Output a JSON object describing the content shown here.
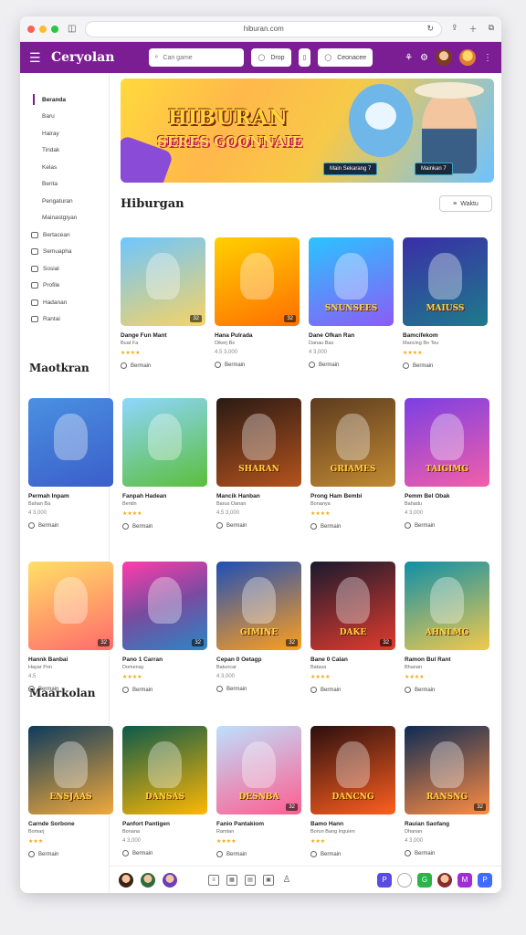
{
  "browser": {
    "url": "hiburan.com",
    "traffic_colors": [
      "#ff5f57",
      "#febc2e",
      "#28c840"
    ]
  },
  "appbar": {
    "brand": "Ceryolan",
    "search_placeholder": "Cari game",
    "filter_label": "Drop",
    "category_label": "Ceonacee"
  },
  "sidebar": {
    "items": [
      "Beranda",
      "Baru",
      "Hairay",
      "Tindak",
      "Kelas",
      "Berita",
      "Pengaturan",
      "Mainastgiyan"
    ],
    "icon_items": [
      "Bertacean",
      "Semuapha",
      "Sosial",
      "Profile",
      "Hadanan",
      "Rantai"
    ],
    "section_label": "Maotkran",
    "section_label_2": "Maarkolan"
  },
  "banner": {
    "title": "HIBURAN",
    "subtitle": "SERES GOONNAIE",
    "btn1": "Main Sekarang 7",
    "btn2": "Mainkan 7"
  },
  "sections": {
    "heading": "Hiburgan",
    "sort_label": "Waktu"
  },
  "rows": [
    {
      "cards": [
        {
          "title": "Dange Fun Mant",
          "sub": "Buat Fa",
          "stars": "★★★★",
          "rating": "",
          "action": "Bermain",
          "badge": "32",
          "logo": "",
          "bg": "linear-gradient(160deg,#6ec6ff,#f6d365)"
        },
        {
          "title": "Hana Pulrada",
          "sub": "Dikerj Bs",
          "stars": "",
          "rating": "4.5  3,000",
          "action": "Bermain",
          "badge": "32",
          "logo": "",
          "bg": "linear-gradient(160deg,#ffd000,#ff6f00)"
        },
        {
          "title": "Dane Ofkan Ran",
          "sub": "Danau Bas",
          "stars": "",
          "rating": "4  3,000",
          "action": "Bermain",
          "badge": "",
          "logo": "SNUNSEES",
          "bg": "linear-gradient(160deg,#2ac4ff,#8b5cf6)"
        },
        {
          "title": "Bamcifekom",
          "sub": "Mancing Bo Teu",
          "stars": "★★★★",
          "rating": "",
          "action": "Bermain",
          "badge": "",
          "logo": "MAIUSS",
          "bg": "linear-gradient(160deg,#3b2ea8,#1d7b8a)"
        }
      ]
    },
    {
      "cards": [
        {
          "title": "Permah Inpam",
          "sub": "Bahan Ba",
          "stars": "",
          "rating": "4  3,000",
          "action": "Bermain",
          "badge": "",
          "logo": "",
          "bg": "linear-gradient(160deg,#4a90e2,#3b5fc9)"
        },
        {
          "title": "Fanpah Hadean",
          "sub": "Bentin",
          "stars": "★★★★",
          "rating": "",
          "action": "Bermain",
          "badge": "",
          "logo": "",
          "bg": "linear-gradient(160deg,#8fd6ff,#5bbf3a)"
        },
        {
          "title": "Mancik Hanban",
          "sub": "Barus Oanan",
          "stars": "",
          "rating": "4.5  3,000",
          "action": "Bermain",
          "badge": "",
          "logo": "SHARAN",
          "bg": "linear-gradient(160deg,#2a1a14,#b4531d)"
        },
        {
          "title": "Prong Ham Bembi",
          "sub": "Bonanya",
          "stars": "★★★★",
          "rating": "",
          "action": "Bermain",
          "badge": "",
          "logo": "GRIAMES",
          "bg": "linear-gradient(160deg,#5c3b1e,#c28a34)"
        },
        {
          "title": "Pemm Bel Obak",
          "sub": "Bahadu",
          "stars": "",
          "rating": "4  3,000",
          "action": "Bermain",
          "badge": "",
          "logo": "TAIGIMG",
          "bg": "linear-gradient(160deg,#7b3fe4,#f35fa8)"
        }
      ]
    },
    {
      "cards": [
        {
          "title": "Hannk Banbai",
          "sub": "Hayar Pon",
          "stars": "",
          "rating": "4.5",
          "action": "Bermain",
          "badge": "32",
          "logo": "",
          "bg": "linear-gradient(160deg,#ffe066,#ff6b6b)"
        },
        {
          "title": "Pano 1 Carran",
          "sub": "Domenay",
          "stars": "★★★★",
          "rating": "",
          "action": "Bermain",
          "badge": "32",
          "logo": "",
          "bg": "linear-gradient(160deg,#ff3cac,#784ba0,#2b86c5)"
        },
        {
          "title": "Cepan 0 Oetagp",
          "sub": "Batuncar",
          "stars": "",
          "rating": "4  3,000",
          "action": "Bermain",
          "badge": "32",
          "logo": "GIMINE",
          "bg": "linear-gradient(160deg,#1f4fb8,#ff9f1c)"
        },
        {
          "title": "Bane 0 Calan",
          "sub": "Batasa",
          "stars": "★★★★",
          "rating": "",
          "action": "Bermain",
          "badge": "32",
          "logo": "DAKE",
          "bg": "linear-gradient(160deg,#1a1a2e,#e23b2e)"
        },
        {
          "title": "Ramon Bul Rant",
          "sub": "Bhanan",
          "stars": "★★★★",
          "rating": "",
          "action": "Bermain",
          "badge": "",
          "logo": "AHNLMG",
          "bg": "linear-gradient(160deg,#0f8fa8,#f2c94c)"
        }
      ]
    },
    {
      "cards": [
        {
          "title": "Carnde Sorbone",
          "sub": "Bomarj",
          "stars": "★★★",
          "rating": "",
          "action": "Bermain",
          "badge": "",
          "logo": "ENSJAAS",
          "bg": "linear-gradient(160deg,#0e3b5c,#f2a93b)"
        },
        {
          "title": "Panfort Pantigen",
          "sub": "Bonana",
          "stars": "",
          "rating": "4  3,000",
          "action": "Bermain",
          "badge": "",
          "logo": "DANSAS",
          "bg": "linear-gradient(160deg,#0c5a4a,#ffb703)"
        },
        {
          "title": "Fanio Pantakiom",
          "sub": "Ramtan",
          "stars": "★★★★",
          "rating": "",
          "action": "Bermain",
          "badge": "32",
          "logo": "DESNBA",
          "bg": "linear-gradient(160deg,#bde0fe,#ff5d8f)"
        },
        {
          "title": "Bamo Hann",
          "sub": "Borun Bang Inguien",
          "stars": "★★★",
          "rating": "",
          "action": "Bermain",
          "badge": "",
          "logo": "DANCNG",
          "bg": "linear-gradient(160deg,#2b0f0f,#ff5f1f)"
        },
        {
          "title": "Rauian Saofang",
          "sub": "Dhanan",
          "stars": "",
          "rating": "4  3,000",
          "action": "Bermain",
          "badge": "32",
          "logo": "RANSNG",
          "bg": "linear-gradient(160deg,#0d2b55,#ff8c42)"
        }
      ]
    }
  ],
  "bottombar": {
    "icons": [
      "list-icon",
      "grid-icon",
      "calendar-icon",
      "gift-icon",
      "user-icon"
    ],
    "right": [
      "P",
      "",
      "G",
      "",
      "M",
      "P"
    ],
    "right_colors": [
      "#5b4be0",
      "#ffffff",
      "#2cb34a",
      "#d44",
      "#a12bd6",
      "#3f6bff"
    ]
  }
}
